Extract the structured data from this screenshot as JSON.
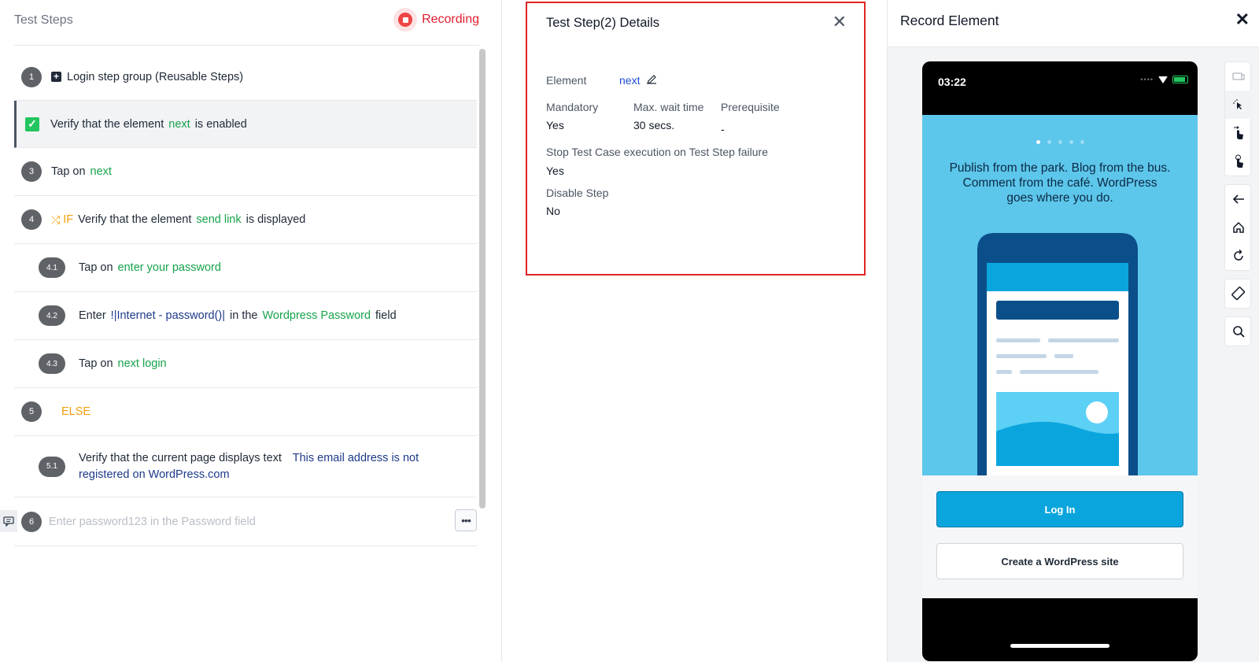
{
  "left": {
    "title": "Test Steps",
    "recording_label": "Recording",
    "steps": [
      {
        "num": "1",
        "text": "Login step group (Reusable Steps)"
      },
      {
        "pre": "Verify that the element",
        "el": "next",
        "post": "is enabled"
      },
      {
        "num": "3",
        "pre": "Tap on",
        "el": "next"
      },
      {
        "num": "4",
        "kw": "IF",
        "pre": "Verify that the element",
        "el": "send link",
        "post": "is displayed"
      },
      {
        "num": "4.1",
        "pre": "Tap on",
        "el": "enter your password"
      },
      {
        "num": "4.2",
        "pre": "Enter",
        "data": "!|Internet - password()|",
        "mid": "in the",
        "el": "Wordpress Password",
        "post": "field"
      },
      {
        "num": "4.3",
        "pre": "Tap on",
        "el": "next login"
      },
      {
        "num": "5",
        "kw": "ELSE"
      },
      {
        "num": "5.1",
        "pre": "Verify that the current page displays text",
        "data1": "This email address is not",
        "data2": "registered on WordPress.com"
      },
      {
        "num": "6",
        "placeholder": "Enter password123 in the Password field"
      }
    ]
  },
  "details": {
    "title": "Test Step(2) Details",
    "element_label": "Element",
    "element_value": "next",
    "mandatory_label": "Mandatory",
    "mandatory_value": "Yes",
    "wait_label": "Max. wait time",
    "wait_value": "30 secs.",
    "prereq_label": "Prerequisite",
    "prereq_value": "-",
    "stop_label": "Stop Test Case execution on Test Step failure",
    "stop_value": "Yes",
    "disable_label": "Disable Step",
    "disable_value": "No"
  },
  "record": {
    "title": "Record Element",
    "phone_time": "03:22",
    "promo_text": "Publish from the park. Blog from the bus. Comment from the café. WordPress goes where you do.",
    "login_label": "Log In",
    "create_label": "Create a WordPress site"
  },
  "colors": {
    "accent_green": "#16a34a",
    "recording_red": "#e11d2e",
    "highlight_border": "#e02424",
    "wp_blue": "#0aa5dd"
  }
}
